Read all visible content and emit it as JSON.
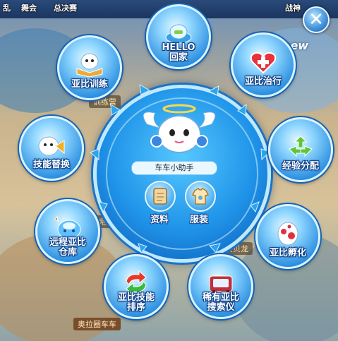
{
  "top_bar": {
    "items": [
      "乱",
      "舞会",
      "总决赛",
      "战神"
    ]
  },
  "background_labels": {
    "trainer": "训练营",
    "player1": "宪见慾",
    "player2": "贝贝龙",
    "plate": "奥拉圈车车",
    "sign": "new"
  },
  "assistant": {
    "name": "车车小助手",
    "buttons": {
      "info": "资料",
      "clothes": "服装"
    }
  },
  "menu": {
    "home": "HELLO\n回家",
    "heal": "亚比治行",
    "exp": "经验分配",
    "hatch": "亚比孵化",
    "radar": "稀有亚比\n搜索仪",
    "skill_sort": "亚比技能\n排序",
    "remote": "远程亚比\n仓库",
    "skill_swap": "技能替换",
    "train": "亚比训练"
  },
  "colors": {
    "accent": "#1f93e8",
    "ring_border": "#bfe9ff",
    "text_outline": "#0d3f8a"
  }
}
